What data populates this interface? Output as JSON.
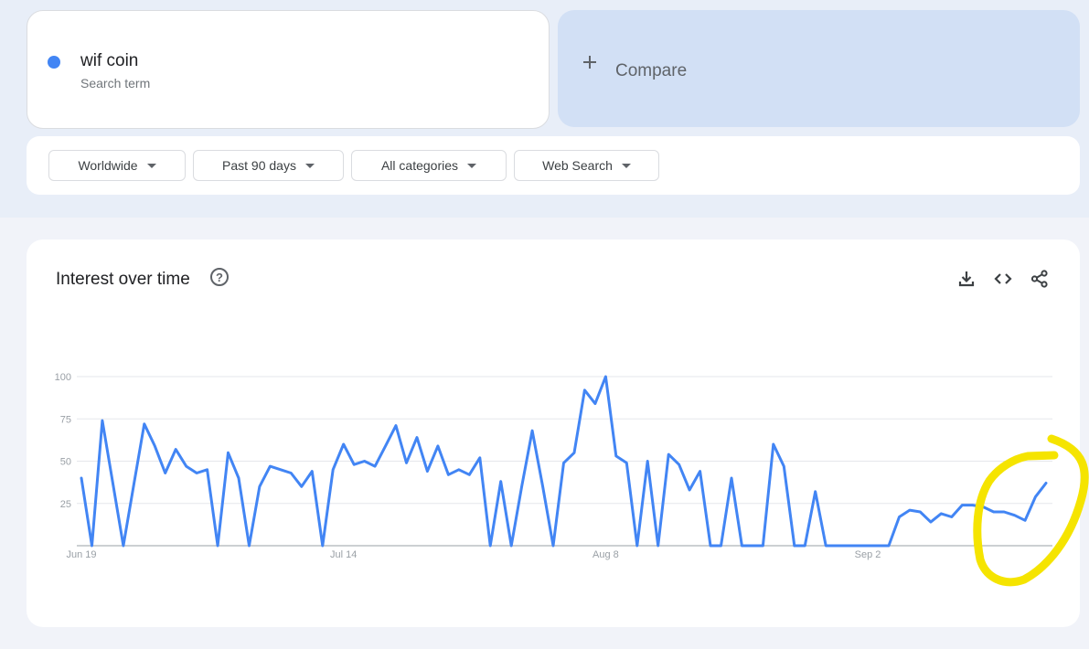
{
  "search_term": {
    "name": "wif coin",
    "subtitle": "Search term",
    "color": "#4285f4"
  },
  "compare": {
    "label": "Compare"
  },
  "filters": [
    {
      "label": "Worldwide"
    },
    {
      "label": "Past 90 days"
    },
    {
      "label": "All categories"
    },
    {
      "label": "Web Search"
    }
  ],
  "chart_section": {
    "title": "Interest over time",
    "icons": [
      "help-icon",
      "download-icon",
      "embed-icon",
      "share-icon"
    ]
  },
  "chart_data": {
    "type": "line",
    "title": "Interest over time",
    "xlabel": "",
    "ylabel": "",
    "ylim": [
      0,
      100
    ],
    "yticks": [
      25,
      50,
      75,
      100
    ],
    "xtick_labels": [
      "Jun 19",
      "Jul 14",
      "Aug 8",
      "Sep 2"
    ],
    "xtick_index": [
      0,
      25,
      50,
      75
    ],
    "grid": true,
    "series": [
      {
        "color": "#4285f4",
        "values": [
          40,
          0,
          74,
          37,
          0,
          36,
          72,
          59,
          43,
          57,
          47,
          43,
          45,
          0,
          55,
          40,
          0,
          35,
          47,
          45,
          43,
          35,
          44,
          0,
          45,
          60,
          48,
          50,
          47,
          59,
          71,
          49,
          64,
          44,
          59,
          42,
          45,
          42,
          52,
          0,
          38,
          0,
          35,
          68,
          35,
          0,
          49,
          55,
          92,
          84,
          100,
          53,
          49,
          0,
          50,
          0,
          54,
          48,
          33,
          44,
          0,
          0,
          40,
          0,
          0,
          0,
          60,
          47,
          0,
          0,
          32,
          0,
          0,
          0,
          0,
          0,
          0,
          0,
          17,
          21,
          20,
          14,
          19,
          17,
          24,
          24,
          23,
          20,
          20,
          18,
          15,
          29,
          37
        ]
      }
    ]
  },
  "annotation": {
    "color": "#f5e400",
    "shape": "hand-drawn-circle"
  }
}
